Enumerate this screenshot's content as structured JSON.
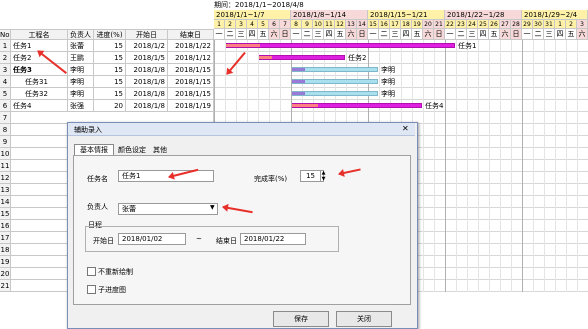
{
  "header": {
    "period_label": "期间：",
    "period_value": "2018/1/1~2018/4/8"
  },
  "columns": {
    "no": "No.",
    "name": "工程名",
    "owner": "负责人",
    "progress": "进度(%)",
    "start": "开始日",
    "end": "结束日"
  },
  "weeks": [
    "2018/1/1~1/7",
    "2018/1/8~1/14",
    "2018/1/15~1/21",
    "2018/1/22~1/28",
    "2018/1/29~2/4"
  ],
  "days": [
    "1",
    "2",
    "3",
    "4",
    "5",
    "6",
    "7",
    "8",
    "9",
    "10",
    "11",
    "12",
    "13",
    "14",
    "15",
    "16",
    "17",
    "18",
    "19",
    "20",
    "21",
    "22",
    "23",
    "24",
    "25",
    "26",
    "27",
    "28",
    "29",
    "30",
    "31",
    "1",
    "2",
    "3"
  ],
  "weekdays": [
    "一",
    "二",
    "三",
    "四",
    "五",
    "六",
    "日",
    "一",
    "二",
    "三",
    "四",
    "五",
    "六",
    "日",
    "一",
    "二",
    "三",
    "四",
    "五",
    "六",
    "日",
    "一",
    "二",
    "三",
    "四",
    "五",
    "六",
    "日",
    "一",
    "二",
    "三",
    "四",
    "五",
    "六"
  ],
  "rows": [
    {
      "no": "1",
      "name": "任务1",
      "owner": "张蕾",
      "progress": "15",
      "start": "2018/1/2",
      "end": "2018/1/22",
      "label": "任务1"
    },
    {
      "no": "2",
      "name": "任务2",
      "owner": "王鹏",
      "progress": "15",
      "start": "2018/1/5",
      "end": "2018/1/12",
      "label": "任务2"
    },
    {
      "no": "3",
      "name": "任务3",
      "owner": "李明",
      "progress": "15",
      "start": "2018/1/8",
      "end": "2018/1/15",
      "label": "李明"
    },
    {
      "no": "4",
      "name": "任务31",
      "owner": "李明",
      "progress": "15",
      "start": "2018/1/8",
      "end": "2018/1/15",
      "label": "李明"
    },
    {
      "no": "5",
      "name": "任务32",
      "owner": "李明",
      "progress": "15",
      "start": "2018/1/8",
      "end": "2018/1/15",
      "label": "李明"
    },
    {
      "no": "6",
      "name": "任务4",
      "owner": "张强",
      "progress": "20",
      "start": "2018/1/8",
      "end": "2018/1/19",
      "label": "任务4"
    }
  ],
  "row_numbers": [
    "7",
    "8",
    "9",
    "10",
    "11",
    "12",
    "13",
    "14",
    "15",
    "16",
    "17",
    "18",
    "19",
    "20",
    "21"
  ],
  "dialog": {
    "title": "辅助录入",
    "tabs": [
      "基本情报",
      "颜色设定",
      "其他"
    ],
    "task_label": "任务名",
    "task_value": "任务1",
    "progress_label": "完成率(%)",
    "progress_value": "15",
    "owner_label": "负责人",
    "owner_value": "张蕾",
    "schedule_label": "日程",
    "start_label": "开始日",
    "start_value": "2018/01/02",
    "tilde": "~",
    "end_label": "结束日",
    "end_value": "2018/01/22",
    "chk1": "不重新绘制",
    "chk2": "子进度图",
    "save": "保存",
    "close": "关闭"
  },
  "colors": {
    "main_bar": "#e020e0",
    "sub_bar": "#a8e0f0",
    "arrow": "#e8302a"
  }
}
